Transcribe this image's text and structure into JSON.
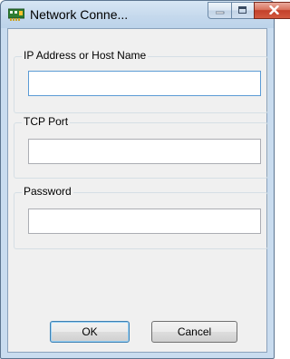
{
  "window": {
    "title": "Network Conne...",
    "icon": "network-card-icon"
  },
  "title_buttons": {
    "minimize_icon": "minimize-icon",
    "maximize_icon": "maximize-icon",
    "close_icon": "close-icon"
  },
  "form": {
    "host": {
      "label": "IP Address or Host Name",
      "value": ""
    },
    "port": {
      "label": "TCP Port",
      "value": ""
    },
    "password": {
      "label": "Password",
      "value": ""
    }
  },
  "buttons": {
    "ok_label": "OK",
    "cancel_label": "Cancel"
  },
  "colors": {
    "frame": "#c9dcef",
    "client": "#f0f0f0",
    "close_button": "#c3402a",
    "focus_border": "#5b9bd5"
  }
}
